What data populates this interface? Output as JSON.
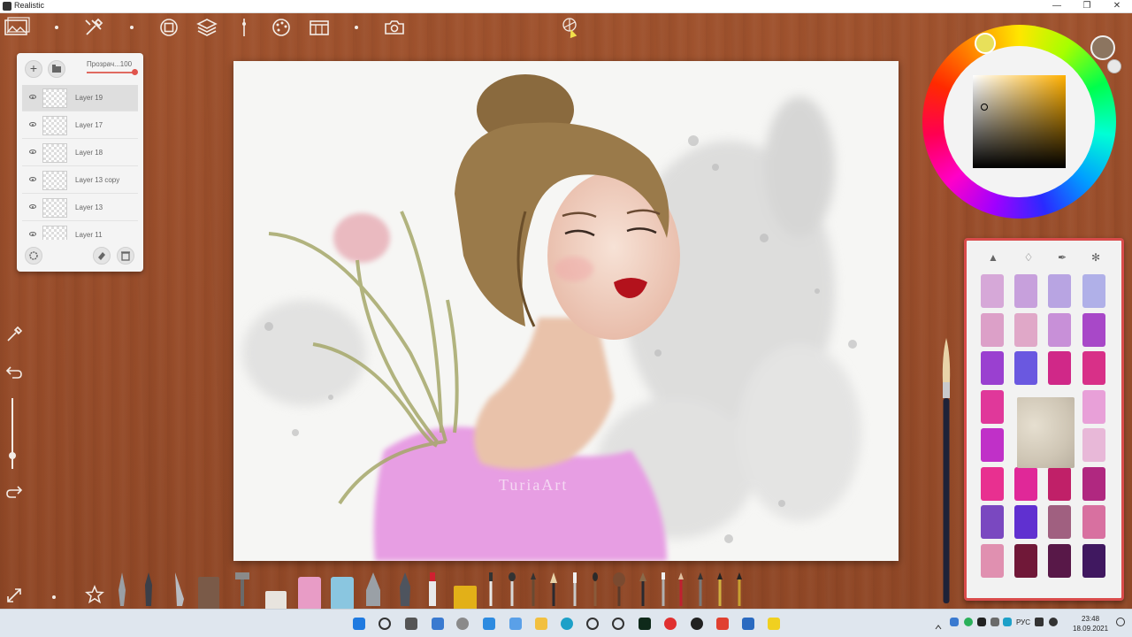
{
  "window": {
    "title": "Realistic",
    "controls": [
      "—",
      "❐",
      "✕"
    ]
  },
  "toolbar": {
    "items": [
      "gallery-icon",
      "tools-icon",
      "transform-icon",
      "layers-icon",
      "brush-settings-icon",
      "palette-icon",
      "paper-icon",
      "camera-icon",
      "compass-icon"
    ]
  },
  "layers_panel": {
    "add_label": "+",
    "opacity_label": "Прозрач...100",
    "layers": [
      {
        "name": "Layer 19",
        "active": true
      },
      {
        "name": "Layer 17",
        "active": false
      },
      {
        "name": "Layer 18",
        "active": false
      },
      {
        "name": "Layer 13 copy",
        "active": false
      },
      {
        "name": "Layer 13",
        "active": false
      },
      {
        "name": "Layer 11",
        "active": false
      }
    ]
  },
  "side_tools": [
    "eyedropper-icon",
    "undo-icon",
    "redo-icon",
    "fullscreen-icon"
  ],
  "artwork": {
    "watermark": "TuriaArt"
  },
  "color_picker": {
    "current_color": "#8c7560",
    "hue_color": "#ffb000"
  },
  "palette": {
    "tools": [
      "watercolor-icon",
      "pen-icon",
      "eyedropper-icon",
      "gear-icon"
    ],
    "swatches": [
      [
        "#d6a8d8",
        "#c7a0dc",
        "#b8a4e2",
        "#b0b0e8"
      ],
      [
        "#dca0c8",
        "#e0a8c8",
        "#c890d8",
        "#a848c8"
      ],
      [
        "#9a40d0",
        "#6a58e0",
        "#d02888",
        "#d83088"
      ],
      [
        "#e0389a",
        "",
        "",
        "#e8a0d8"
      ],
      [
        "#c030c8",
        "",
        "",
        "#e8b8d8"
      ],
      [
        "#e83090",
        "#e02898",
        "#c02068",
        "#b02880"
      ],
      [
        "#7a48c0",
        "#6030d0",
        "#a06080",
        "#d870a0"
      ],
      [
        "#e090b0",
        "#701838",
        "#581848",
        "#401860"
      ]
    ]
  },
  "taskbar": {
    "time": "23:48",
    "date": "18.09.2021",
    "lang": "РУС"
  }
}
